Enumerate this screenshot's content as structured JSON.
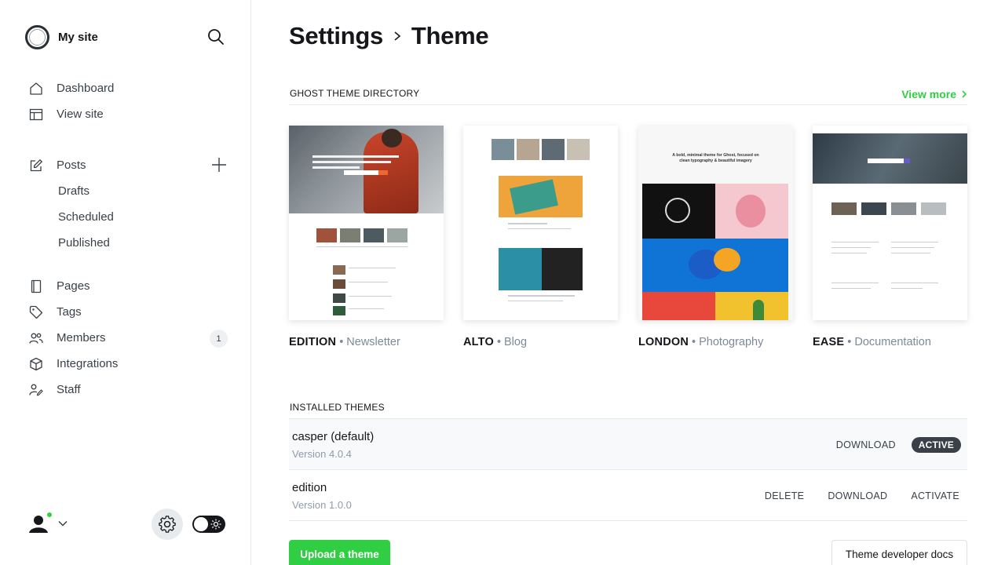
{
  "sidebar": {
    "site_name": "My site",
    "nav": [
      {
        "label": "Dashboard"
      },
      {
        "label": "View site"
      }
    ],
    "posts": {
      "label": "Posts",
      "sub": [
        {
          "label": "Drafts"
        },
        {
          "label": "Scheduled"
        },
        {
          "label": "Published"
        }
      ]
    },
    "nav2": [
      {
        "label": "Pages"
      },
      {
        "label": "Tags"
      },
      {
        "label": "Members",
        "badge": "1"
      },
      {
        "label": "Integrations"
      },
      {
        "label": "Staff"
      }
    ],
    "online_color": "#30cf43"
  },
  "header": {
    "breadcrumb_parent": "Settings",
    "breadcrumb_current": "Theme"
  },
  "directory": {
    "label": "Ghost theme directory",
    "view_more": "View more",
    "themes": [
      {
        "name": "EDITION",
        "category": "Newsletter"
      },
      {
        "name": "ALTO",
        "category": "Blog"
      },
      {
        "name": "LONDON",
        "category": "Photography"
      },
      {
        "name": "EASE",
        "category": "Documentation"
      }
    ],
    "thumb_text": {
      "london_tagline": "A bold, minimal theme for Ghost, focused on clean typography & beautiful imagery"
    }
  },
  "installed": {
    "label": "Installed themes",
    "themes": [
      {
        "name": "casper (default)",
        "version": "Version 4.0.4",
        "download": "DOWNLOAD",
        "status": "ACTIVE"
      },
      {
        "name": "edition",
        "version": "Version 1.0.0",
        "delete": "DELETE",
        "download": "DOWNLOAD",
        "activate": "ACTIVATE"
      }
    ]
  },
  "actions": {
    "upload": "Upload a theme",
    "docs": "Theme developer docs"
  },
  "colors": {
    "accent_green": "#30cf43",
    "dark": "#15171a",
    "active_pill": "#394047"
  }
}
